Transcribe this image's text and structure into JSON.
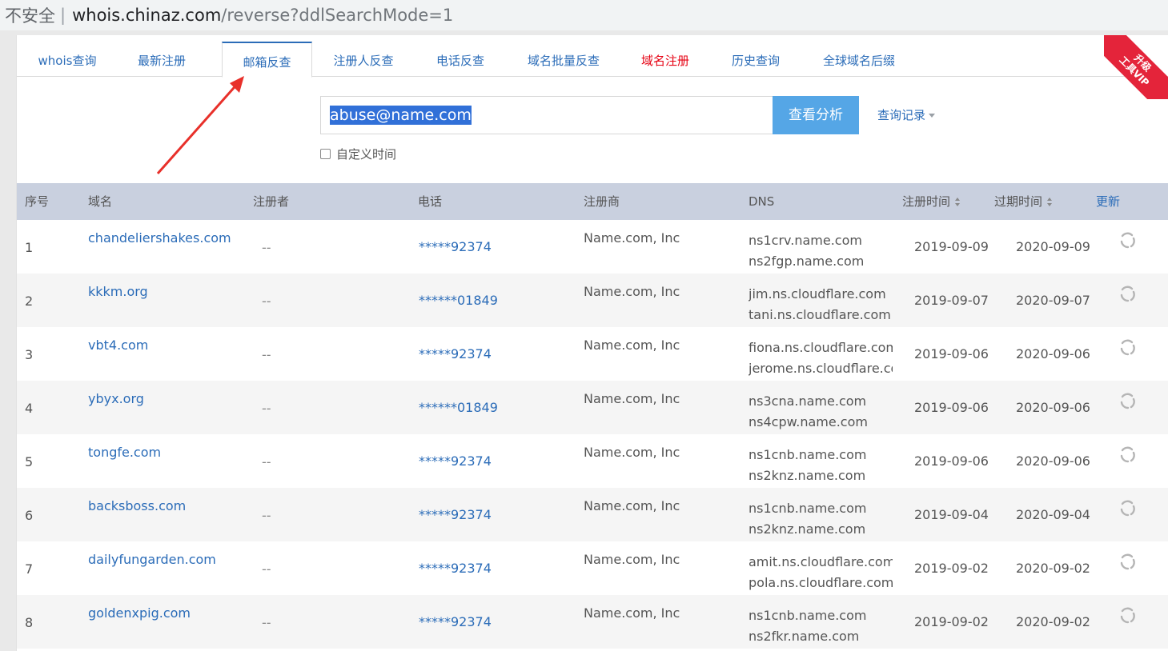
{
  "browser": {
    "insecure_label": "不安全",
    "host": "whois.chinaz.com",
    "path": "/reverse?ddlSearchMode=1"
  },
  "tabs": [
    {
      "label": "whois查询"
    },
    {
      "label": "最新注册"
    },
    {
      "label": "邮箱反查"
    },
    {
      "label": "注册人反查"
    },
    {
      "label": "电话反查"
    },
    {
      "label": "域名批量反查"
    },
    {
      "label": "域名注册"
    },
    {
      "label": "历史查询"
    },
    {
      "label": "全球域名后缀"
    }
  ],
  "active_tab": "邮箱反查",
  "vip_badge": {
    "line1": "升级",
    "line2": "工具VIP"
  },
  "search": {
    "value": "abuse@name.com",
    "button_label": "查看分析",
    "history_label": "查询记录",
    "custom_time_label": "自定义时间"
  },
  "table": {
    "headers": {
      "index": "序号",
      "domain": "域名",
      "registrant": "注册者",
      "phone": "电话",
      "registrar": "注册商",
      "dns": "DNS",
      "reg_date": "注册时间",
      "exp_date": "过期时间",
      "update": "更新"
    },
    "rows": [
      {
        "index": "1",
        "domain": "chandeliershakes.com",
        "registrant": "--",
        "phone": "*****92374",
        "registrar": "Name.com, Inc",
        "dns1": "ns1crv.name.com",
        "dns2": "ns2fgp.name.com",
        "reg_date": "2019-09-09",
        "exp_date": "2020-09-09"
      },
      {
        "index": "2",
        "domain": "kkkm.org",
        "registrant": "--",
        "phone": "******01849",
        "registrar": "Name.com, Inc",
        "dns1": "jim.ns.cloudflare.com",
        "dns2": "tani.ns.cloudflare.com",
        "reg_date": "2019-09-07",
        "exp_date": "2020-09-07"
      },
      {
        "index": "3",
        "domain": "vbt4.com",
        "registrant": "--",
        "phone": "*****92374",
        "registrar": "Name.com, Inc",
        "dns1": "fiona.ns.cloudflare.com",
        "dns2": "jerome.ns.cloudflare.co",
        "reg_date": "2019-09-06",
        "exp_date": "2020-09-06"
      },
      {
        "index": "4",
        "domain": "ybyx.org",
        "registrant": "--",
        "phone": "******01849",
        "registrar": "Name.com, Inc",
        "dns1": "ns3cna.name.com",
        "dns2": "ns4cpw.name.com",
        "reg_date": "2019-09-06",
        "exp_date": "2020-09-06"
      },
      {
        "index": "5",
        "domain": "tongfe.com",
        "registrant": "--",
        "phone": "*****92374",
        "registrar": "Name.com, Inc",
        "dns1": "ns1cnb.name.com",
        "dns2": "ns2knz.name.com",
        "reg_date": "2019-09-06",
        "exp_date": "2020-09-06"
      },
      {
        "index": "6",
        "domain": "backsboss.com",
        "registrant": "--",
        "phone": "*****92374",
        "registrar": "Name.com, Inc",
        "dns1": "ns1cnb.name.com",
        "dns2": "ns2knz.name.com",
        "reg_date": "2019-09-04",
        "exp_date": "2020-09-04"
      },
      {
        "index": "7",
        "domain": "dailyfungarden.com",
        "registrant": "--",
        "phone": "*****92374",
        "registrar": "Name.com, Inc",
        "dns1": "amit.ns.cloudflare.com",
        "dns2": "pola.ns.cloudflare.com",
        "reg_date": "2019-09-02",
        "exp_date": "2020-09-02"
      },
      {
        "index": "8",
        "domain": "goldenxpig.com",
        "registrant": "--",
        "phone": "*****92374",
        "registrar": "Name.com, Inc",
        "dns1": "ns1cnb.name.com",
        "dns2": "ns2fkr.name.com",
        "reg_date": "2019-09-02",
        "exp_date": "2020-09-02"
      }
    ]
  },
  "colors": {
    "link": "#2b6cb8",
    "accent_red": "#e60012",
    "button": "#55a6e6",
    "header_bg": "#c9d0df",
    "annotation": "#e8302a"
  },
  "icons": {
    "refresh": "refresh-icon",
    "annotation_arrow": "red-arrow-annotation"
  }
}
